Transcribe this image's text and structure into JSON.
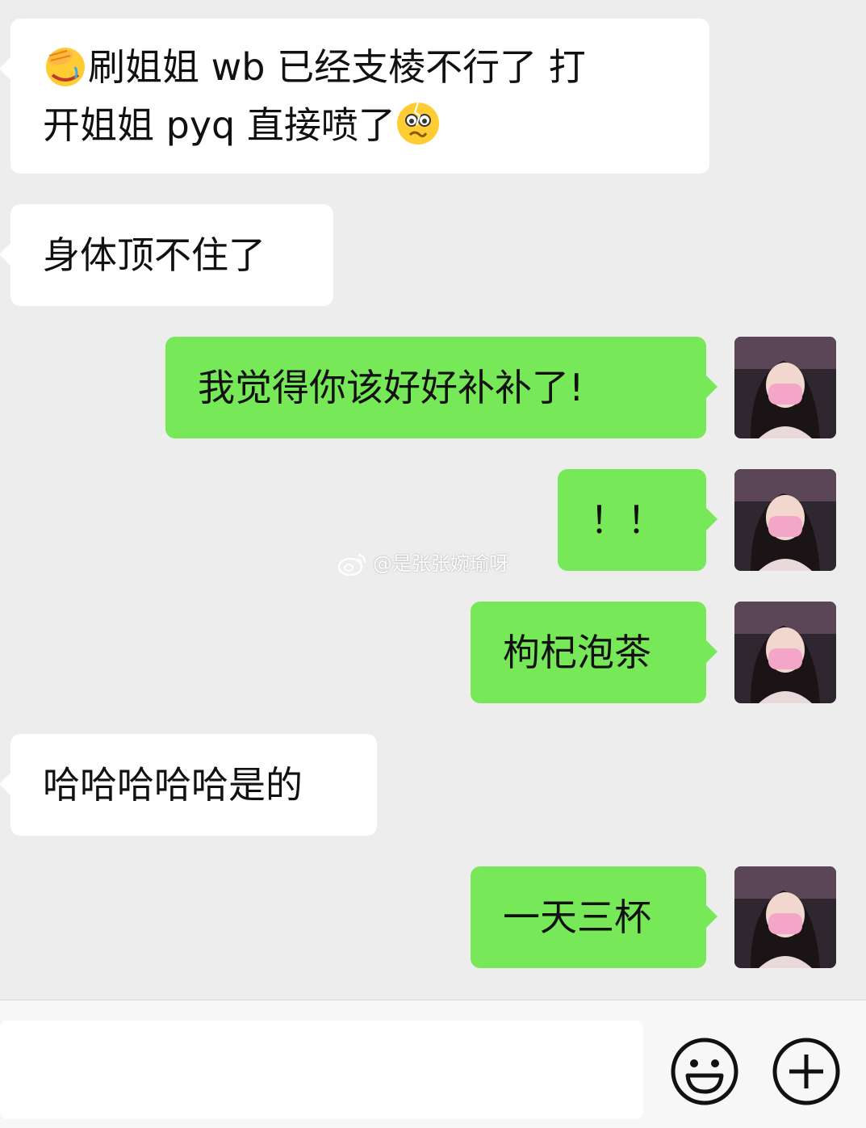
{
  "messages": [
    {
      "direction": "incoming",
      "lines": [
        "刷姐姐 wb  已经支棱不行了  打",
        "开姐姐 pyq 直接喷了"
      ],
      "lead_emoji": "facepalm-emoji",
      "trail_emoji": "nervous-face-emoji"
    },
    {
      "direction": "incoming",
      "text": "身体顶不住了"
    },
    {
      "direction": "outgoing",
      "text": "我觉得你该好好补补了!"
    },
    {
      "direction": "outgoing",
      "text": "！！"
    },
    {
      "direction": "outgoing",
      "text": "枸杞泡茶"
    },
    {
      "direction": "incoming",
      "text": "哈哈哈哈哈是的"
    },
    {
      "direction": "outgoing",
      "text": "一天三杯"
    }
  ],
  "watermark": {
    "text": "@是张张婉瑜呀",
    "icon": "weibo-logo-icon"
  },
  "input_bar": {
    "input_value": "",
    "emoji_button_icon": "smiley-face-icon",
    "more_button_icon": "plus-circle-icon"
  },
  "colors": {
    "background": "#ededed",
    "incoming_bubble": "#ffffff",
    "outgoing_bubble": "#77e958",
    "text": "#111111"
  }
}
